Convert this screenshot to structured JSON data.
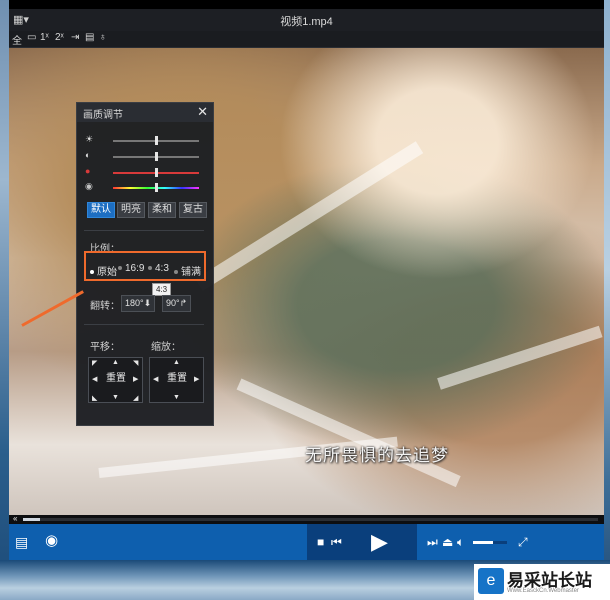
{
  "window": {
    "title": "视频1.mp4",
    "menu_icon": "hamburger-menu-icon",
    "dropdown_arrow": "▾"
  },
  "toolbar": {
    "items": [
      "全",
      "▭",
      "1ˣ",
      "2ˣ",
      "⇥",
      "▤",
      "♁"
    ],
    "speed_1x": "1ˣ",
    "speed_2x": "2ˣ"
  },
  "video": {
    "subtitle": "无所畏惧的去追梦"
  },
  "panel": {
    "title": "画质调节",
    "close": "✕",
    "sliders": [
      {
        "icon": "sun-icon",
        "glyph": "☀",
        "level": 0.5,
        "track_color": "#777777"
      },
      {
        "icon": "contrast-icon",
        "glyph": "◐",
        "level": 0.5,
        "track_color": "#777777"
      },
      {
        "icon": "saturation-icon",
        "glyph": "●",
        "level": 0.5,
        "track_color": "#d83a3a"
      },
      {
        "icon": "hue-icon",
        "glyph": "◉",
        "level": 0.5,
        "track_color": "rainbow"
      }
    ],
    "presets": [
      {
        "label": "默认",
        "active": true
      },
      {
        "label": "明亮",
        "active": false
      },
      {
        "label": "柔和",
        "active": false
      },
      {
        "label": "复古",
        "active": false
      }
    ],
    "ratio_label": "比例：",
    "ratios": [
      {
        "label": "原始",
        "selected": true
      },
      {
        "label": "16:9",
        "selected": false
      },
      {
        "label": "4:3",
        "selected": false
      },
      {
        "label": "铺满",
        "selected": false
      }
    ],
    "tooltip": "4:3",
    "rotate_label": "翻转：",
    "rotate_180": "180°",
    "rotate_90": "90°",
    "pan_label": "平移：",
    "zoom_label": "缩放：",
    "reset_label": "重置"
  },
  "controls": {
    "playlist_icon": "playlist-icon",
    "eye_icon": "eye-icon",
    "stop_icon": "stop-icon",
    "prev_icon": "previous-icon",
    "play_icon": "play-icon",
    "next_icon": "next-icon",
    "eject_icon": "eject-icon",
    "volume_icon": "volume-icon",
    "fullscreen_icon": "fullscreen-icon",
    "volume_level": 0.6,
    "progress": 0.03
  },
  "watermark": {
    "text": "易采站长站",
    "url": "Www.EasckCn.Webmaster"
  },
  "colors": {
    "accent": "#1d6ec2",
    "highlight_box": "#ef6a2c",
    "control_bar": "#0e5fae"
  }
}
